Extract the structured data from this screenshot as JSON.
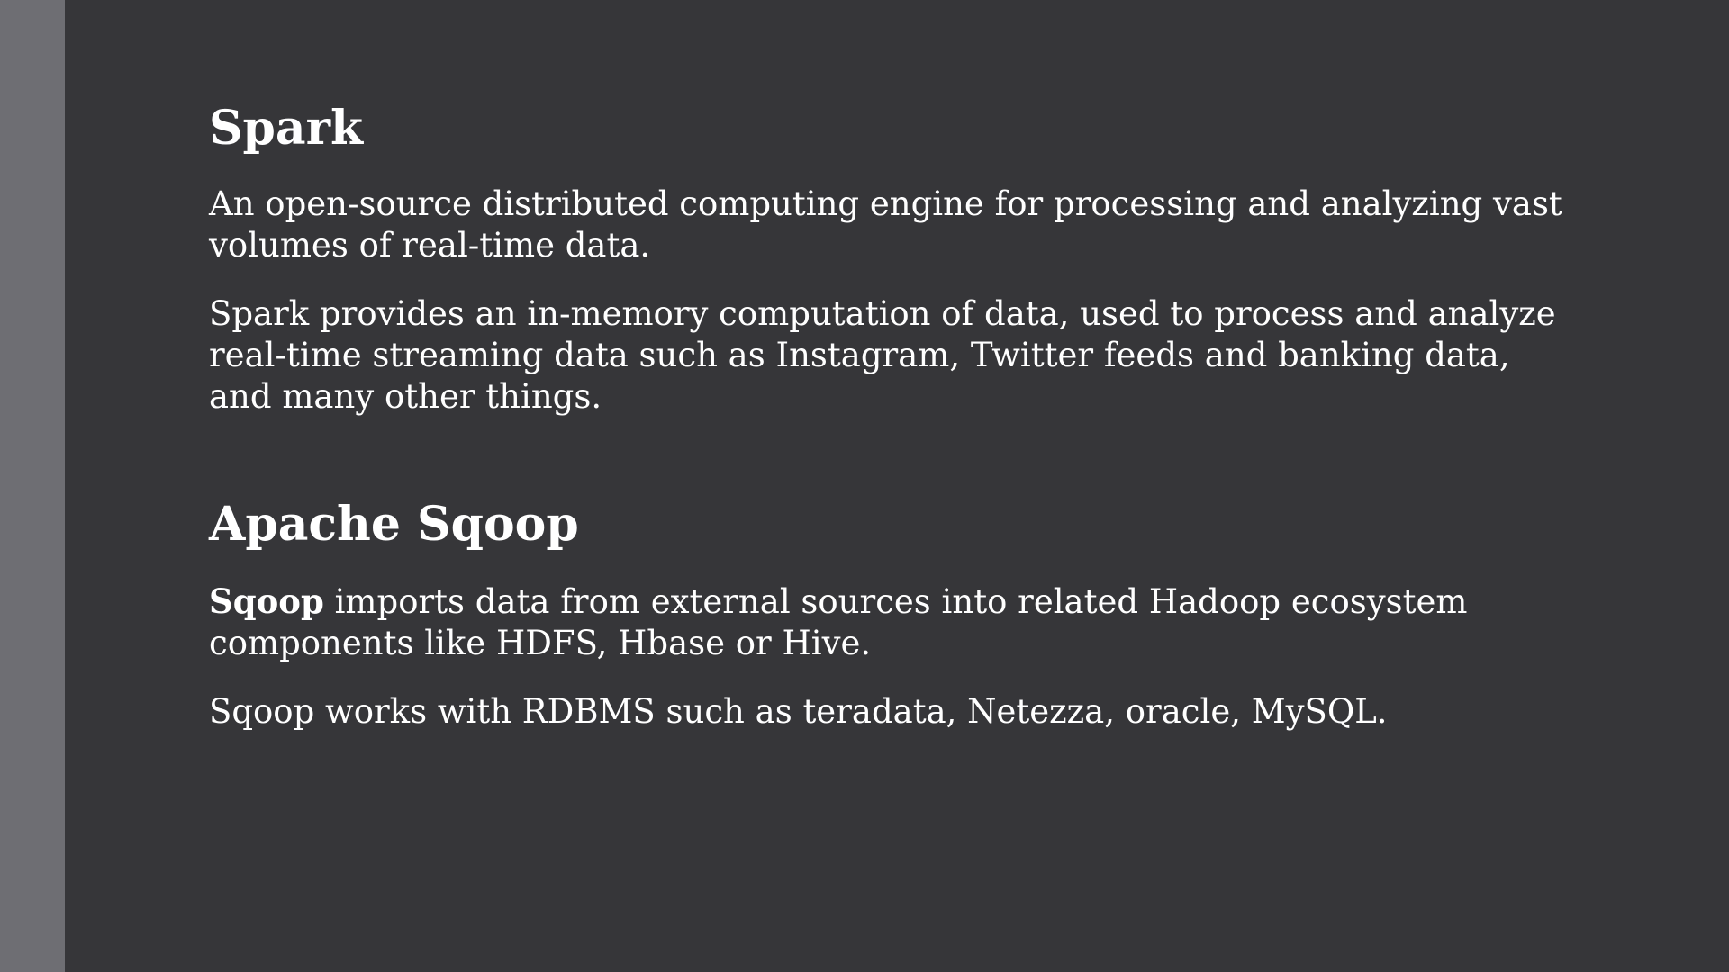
{
  "sections": [
    {
      "heading": "Spark",
      "paragraphs": [
        "An open-source distributed computing engine for processing and analyzing vast volumes of real-time data.",
        "Spark provides an in-memory computation of data, used to process and analyze real-time streaming data such as Instagram, Twitter feeds and banking data, and many other things."
      ]
    },
    {
      "heading": "Apache Sqoop",
      "lead_bold": "Sqoop",
      "lead_rest": " imports data from external sources into related Hadoop ecosystem components like HDFS, Hbase or Hive.",
      "paragraphs": [
        "Sqoop works with RDBMS such as teradata, Netezza, oracle, MySQL."
      ]
    }
  ],
  "colors": {
    "background": "#363639",
    "side_bar": "#6e6e73",
    "text": "#ffffff"
  }
}
